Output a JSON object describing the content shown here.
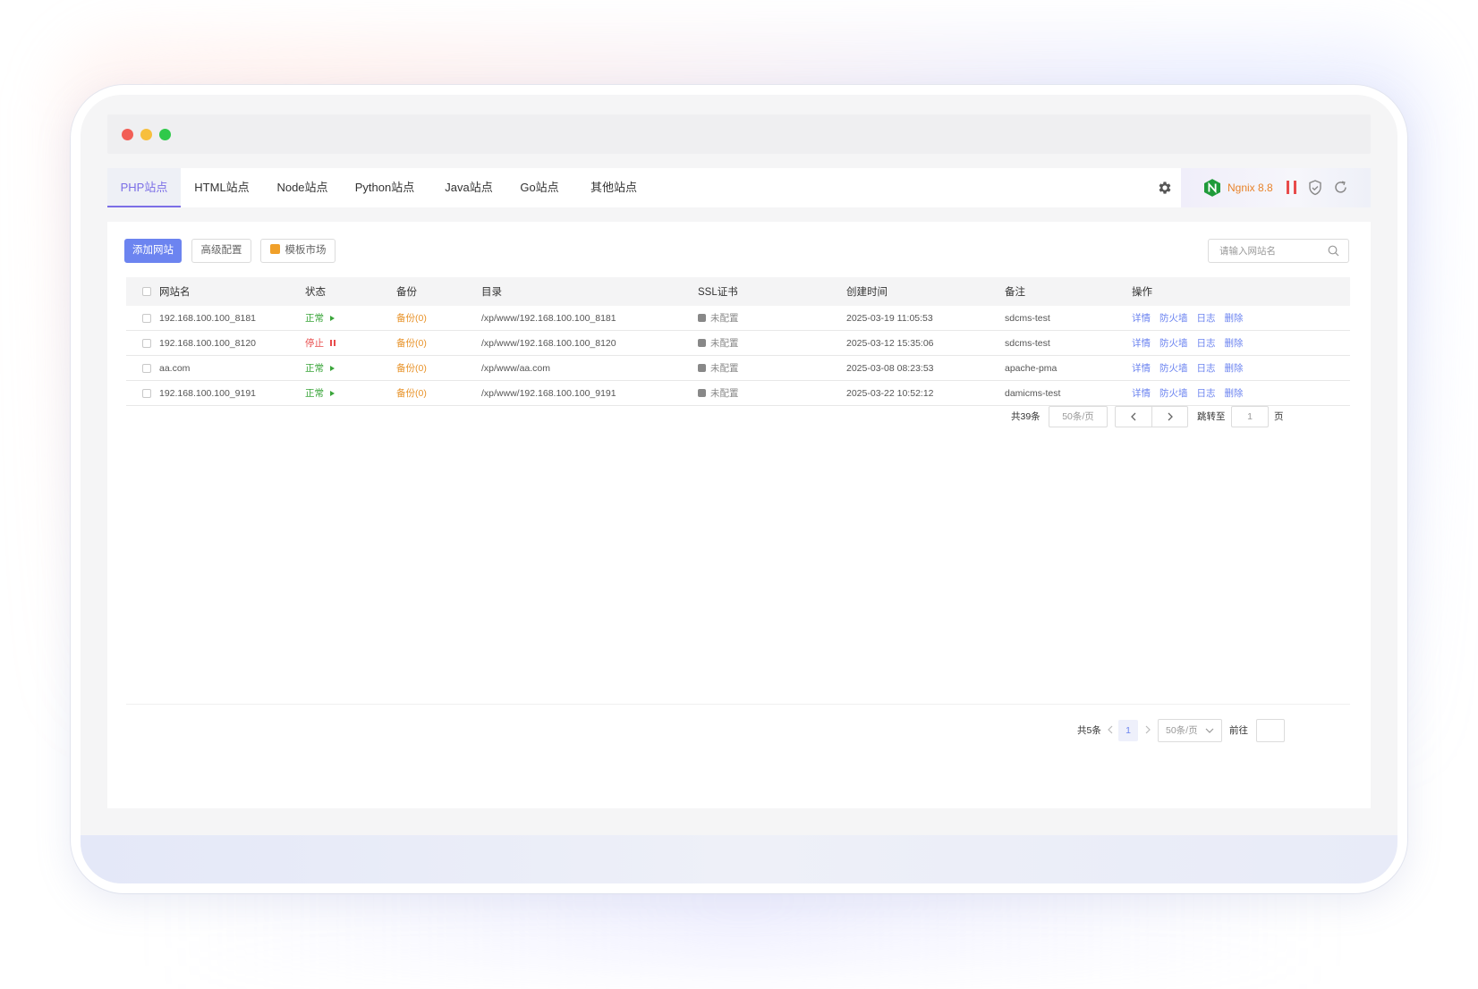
{
  "window": {
    "traffic_lights": [
      "#f25f57",
      "#f7bf3d",
      "#2fc94a"
    ]
  },
  "tabs": [
    {
      "label": "PHP站点",
      "active": true
    },
    {
      "label": "HTML站点",
      "active": false
    },
    {
      "label": "Node站点",
      "active": false
    },
    {
      "label": "Python站点",
      "active": false
    },
    {
      "label": "Java站点",
      "active": false
    },
    {
      "label": "Go站点",
      "active": false
    },
    {
      "label": "其他站点",
      "active": false
    }
  ],
  "server": {
    "name": "Ngnix 8.8",
    "icons": [
      "settings-icon",
      "nginx-logo-icon",
      "pause-icon",
      "shield-icon",
      "refresh-icon"
    ]
  },
  "toolbar": {
    "add_site": "添加网站",
    "advanced": "高级配置",
    "templates": "模板市场",
    "search_placeholder": "请输入网站名"
  },
  "table": {
    "columns": [
      "网站名",
      "状态",
      "备份",
      "目录",
      "SSL证书",
      "创建时间",
      "备注",
      "操作"
    ],
    "rows": [
      {
        "name": "192.168.100.100_8181",
        "status": "正常",
        "status_type": "ok",
        "backup": "备份(0)",
        "dir": "/xp/www/192.168.100.100_8181",
        "ssl": "未配置",
        "created": "2025-03-19 11:05:53",
        "note": "sdcms-test"
      },
      {
        "name": "192.168.100.100_8120",
        "status": "停止",
        "status_type": "stop",
        "backup": "备份(0)",
        "dir": "/xp/www/192.168.100.100_8120",
        "ssl": "未配置",
        "created": "2025-03-12 15:35:06",
        "note": "sdcms-test"
      },
      {
        "name": "aa.com",
        "status": "正常",
        "status_type": "ok",
        "backup": "备份(0)",
        "dir": "/xp/www/aa.com",
        "ssl": "未配置",
        "created": "2025-03-08 08:23:53",
        "note": "apache-pma"
      },
      {
        "name": "192.168.100.100_9191",
        "status": "正常",
        "status_type": "ok",
        "backup": "备份(0)",
        "dir": "/xp/www/192.168.100.100_9191",
        "ssl": "未配置",
        "created": "2025-03-22 10:52:12",
        "note": "damicms-test"
      }
    ],
    "actions": [
      "详情",
      "防火墙",
      "日志",
      "删除"
    ]
  },
  "pager_top": {
    "total": "共39条",
    "page_size": "50条/页",
    "goto_label": "跳转至",
    "goto_value": "1",
    "page_suffix": "页"
  },
  "pager_bottom": {
    "total": "共5条",
    "current_page": "1",
    "page_size": "50条/页",
    "goto_label": "前往",
    "goto_value": ""
  }
}
